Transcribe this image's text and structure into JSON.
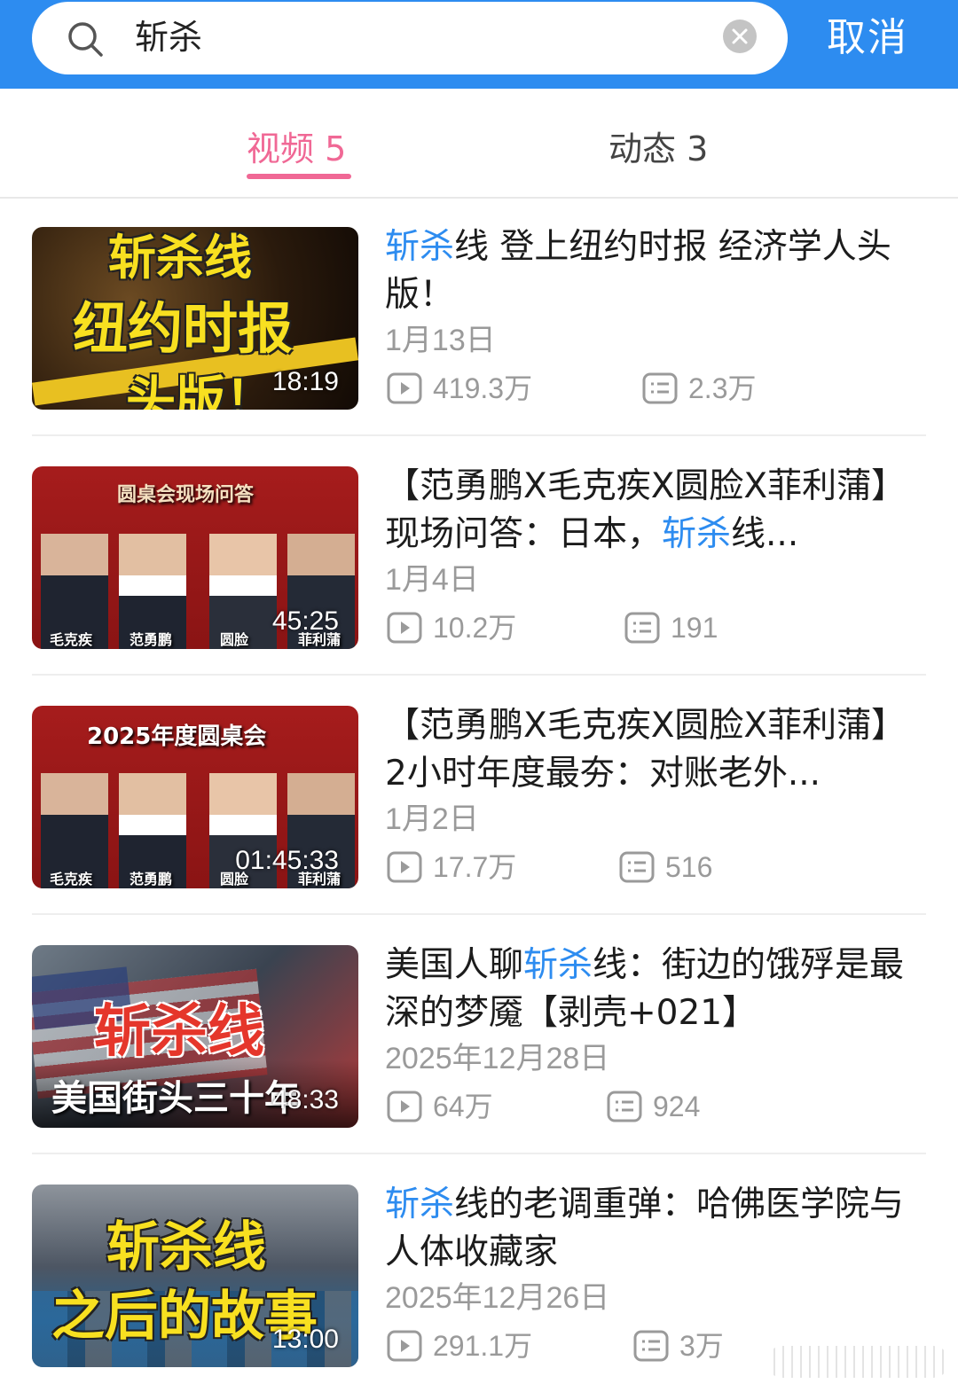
{
  "search": {
    "query": "斩杀",
    "cancel_label": "取消"
  },
  "tabs": [
    {
      "label": "视频 5",
      "active": true
    },
    {
      "label": "动态 3",
      "active": false
    }
  ],
  "colors": {
    "header_bg": "#2d8cf0",
    "accent_pink": "#f06895",
    "highlight_blue": "#2d8cf0"
  },
  "results": [
    {
      "title_parts": [
        "斩杀",
        "线 登上纽约时报 经济学人头版！"
      ],
      "date": "1月13日",
      "duration": "18:19",
      "views": "419.3万",
      "comments": "2.3万",
      "thumb_lines": [
        "斩杀线",
        "纽约时报",
        "头版！"
      ]
    },
    {
      "title_parts": [
        "【范勇鹏X毛克疾X圆脸X菲利蒲】现场问答：日本，",
        "斩杀",
        "线..."
      ],
      "date": "1月4日",
      "duration": "45:25",
      "views": "10.2万",
      "comments": "191",
      "thumb_lines": [
        "圆桌会现场问答",
        "毛克疾",
        "范勇鹏",
        "圆脸",
        "菲利蒲"
      ]
    },
    {
      "title_parts": [
        "【范勇鹏X毛克疾X圆脸X菲利蒲】2小时年度最夯：对账老外..."
      ],
      "date": "1月2日",
      "duration": "01:45:33",
      "views": "17.7万",
      "comments": "516",
      "thumb_lines": [
        "2025年度圆桌会",
        "毛克疾",
        "范勇鹏",
        "圆脸",
        "菲利蒲"
      ]
    },
    {
      "title_parts": [
        "美国人聊",
        "斩杀",
        "线：街边的饿殍是最深的梦魇【剥壳+021】"
      ],
      "date": "2025年12月28日",
      "duration": "48:33",
      "views": "64万",
      "comments": "924",
      "thumb_lines": [
        "斩杀线",
        "美国街头三十年"
      ]
    },
    {
      "title_parts": [
        "斩杀",
        "线的老调重弹：哈佛医学院与人体收藏家"
      ],
      "date": "2025年12月26日",
      "duration": "13:00",
      "views": "291.1万",
      "comments": "3万",
      "thumb_lines": [
        "斩杀线",
        "之后的故事"
      ]
    }
  ]
}
